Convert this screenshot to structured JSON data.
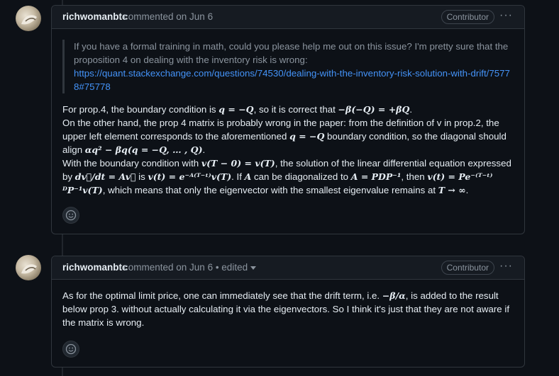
{
  "comments": [
    {
      "author": "richwomanbtc",
      "meta": "commented on Jun 6",
      "badge": "Contributor",
      "menu": "···",
      "quote_text": "If you have a formal training in math, could you please help me out on this issue? I'm pretty sure that the proposition 4 on dealing with the inventory risk is wrong:",
      "quote_link": "https://quant.stackexchange.com/questions/74530/dealing-with-the-inventory-risk-solution-with-drift/75778#75778",
      "p1": [
        "For prop.4, the boundary condition is ",
        "q = −Q",
        ", so it is correct that ",
        "−β(−Q) = +βQ",
        "."
      ],
      "p2": [
        "On the other hand, the prop 4 matrix is probably wrong in the paper: from the definition of v in prop.2, the upper left element corresponds to the aforementioned ",
        "q = −Q",
        " boundary condition, so the diagonal should align ",
        "αq² − βq(q = −Q, … , Q)",
        "."
      ],
      "p3": [
        "With the boundary condition with ",
        "v(T − 0) = v(T)",
        ", the solution of the linear differential equation expressed by ",
        "dv⃗/dt = Av⃗",
        " is ",
        "v(t) = e⁻ᴬ⁽ᵀ⁻ᵗ⁾v(T)",
        ". If ",
        "A",
        " can be diagonalized to ",
        "A = PDP⁻¹",
        ", then ",
        "v(t) = Pe⁻⁽ᵀ⁻ᵗ⁾ᴰP⁻¹v(T)",
        ", which means that only the eigenvector with the smallest eigenvalue remains at ",
        "T → ∞",
        "."
      ]
    },
    {
      "author": "richwomanbtc",
      "meta": "commented on Jun 6 • edited",
      "badge": "Contributor",
      "menu": "···",
      "p1": [
        "As for the optimal limit price, one can immediately see that the drift term, i.e. ",
        "−β/α",
        ", is added to the result below prop 3. without actually calculating it via the eigenvectors. So I think it's just that they are not aware if the matrix is wrong."
      ]
    }
  ]
}
